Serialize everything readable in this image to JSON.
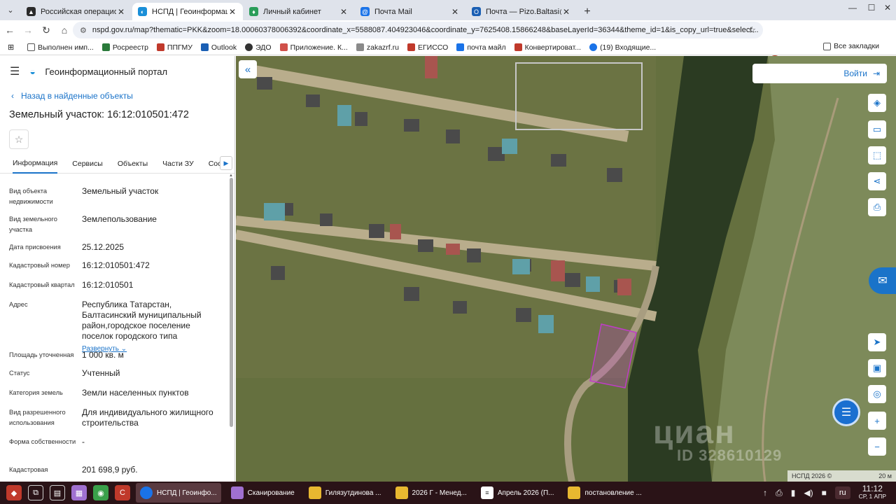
{
  "browser": {
    "tabs": [
      {
        "label": "Российская операционна",
        "color": "#2b2b2b",
        "active": false
      },
      {
        "label": "НСПД | Геоинформацио",
        "color": "#1a8fd8",
        "active": true
      },
      {
        "label": "Личный кабинет",
        "color": "#2a9d5a",
        "active": false
      },
      {
        "label": "Почта Mail",
        "color": "#1a73e8",
        "active": false
      },
      {
        "label": "Почта — Pizo.Baltasi@tatar",
        "color": "#1a5fb4",
        "active": false
      }
    ],
    "url": "nspd.gov.ru/map?thematic=PKK&zoom=18.00060378006392&coordinate_x=5588087.404923046&coordinate_y=7625408.15866248&baseLayerId=36344&theme_id=1&is_copy_url=true&select...",
    "bookmarks": [
      {
        "label": "Выполнен имп...",
        "color": "#7a5a2a"
      },
      {
        "label": "Росреестр",
        "color": "#2a7a3a"
      },
      {
        "label": "ППГМУ",
        "color": "#c0392b"
      },
      {
        "label": "Outlook",
        "color": "#1a5fb4"
      },
      {
        "label": "ЭДО",
        "color": "#333333"
      },
      {
        "label": "Приложение. К...",
        "color": "#d0504a"
      },
      {
        "label": "zakazrf.ru",
        "color": "#8a8a8a"
      },
      {
        "label": "ЕГИССО",
        "color": "#c0392b"
      },
      {
        "label": "почта майл",
        "color": "#1a73e8"
      },
      {
        "label": "Конвертироват...",
        "color": "#c0392b"
      },
      {
        "label": "(19) Входящие...",
        "color": "#1a73e8"
      }
    ],
    "all_bookmarks": "Все закладки"
  },
  "panel": {
    "portal_title": "Геоинформационный портал",
    "back_link": "Назад в найденные объекты",
    "title": "Земельный участок: 16:12:010501:472",
    "tabs": [
      "Информация",
      "Сервисы",
      "Объекты",
      "Части ЗУ",
      "Состав"
    ],
    "expand_label": "Развернуть",
    "properties": [
      {
        "label": "Вид объекта недвижимости",
        "value": "Земельный участок"
      },
      {
        "label": "Вид земельного участка",
        "value": "Землепользование"
      },
      {
        "label": "Дата присвоения",
        "value": "25.12.2025"
      },
      {
        "label": "Кадастровый номер",
        "value": "16:12:010501:472"
      },
      {
        "label": "Кадастровый квартал",
        "value": "16:12:010501"
      },
      {
        "label": "Адрес",
        "value": "Республика Татарстан, Балтасинский муниципальный район,городское поселение поселок городского типа"
      },
      {
        "label": "Площадь уточненная",
        "value": "1 000 кв. м"
      },
      {
        "label": "Статус",
        "value": "Учтенный"
      },
      {
        "label": "Категория земель",
        "value": "Земли населенных пунктов"
      },
      {
        "label": "Вид разрешенного использования",
        "value": "Для индивидуального жилищного строительства"
      },
      {
        "label": "Форма собственности",
        "value": "-"
      },
      {
        "label": "Кадастровая",
        "value": "201 698,9 руб."
      }
    ]
  },
  "map": {
    "login": "Войти",
    "watermark": "циан",
    "watermark_id": "ID 328610129",
    "copyright": "НСПД 2026 ©",
    "scale": "20 м",
    "parcel_color": "#c03cc8"
  },
  "taskbar": {
    "apps": [
      {
        "label": "НСПД | Геоинфо...",
        "color": "#1a73e8",
        "active": true
      },
      {
        "label": "Сканирование",
        "color": "#a070d0",
        "active": false
      },
      {
        "label": "Гилязутдинова ...",
        "color": "#e8b830",
        "active": false
      },
      {
        "label": "2026 Г - Менед...",
        "color": "#e8b830",
        "active": false
      },
      {
        "label": "Апрель 2026 (П...",
        "color": "#ffffff",
        "active": false
      },
      {
        "label": "постановление ...",
        "color": "#e8b830",
        "active": false
      }
    ],
    "lang": "ru",
    "time": "11:12",
    "date": "СР, 1 АПР"
  }
}
